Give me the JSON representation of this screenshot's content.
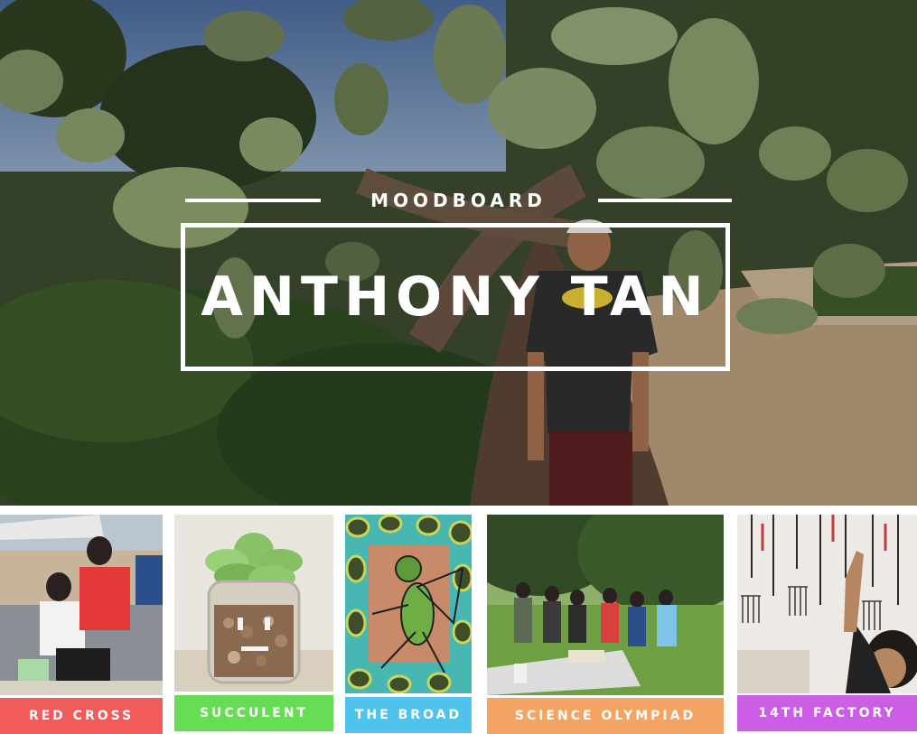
{
  "moodboard": {
    "subtitle": "MOODBOARD",
    "title": "ANTHONY TAN"
  },
  "tiles": [
    {
      "label": "RED CROSS",
      "color": "#f15b5b"
    },
    {
      "label": "SUCCULENT",
      "color": "#66dd55"
    },
    {
      "label": "THE BROAD",
      "color": "#4fc3ec"
    },
    {
      "label": "SCIENCE OLYMPIAD",
      "color": "#f4a462"
    },
    {
      "label": "14TH FACTORY",
      "color": "#cc5ee6"
    }
  ],
  "colors": {
    "text": "#ffffff",
    "background": "#ffffff"
  }
}
